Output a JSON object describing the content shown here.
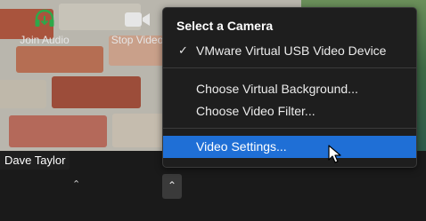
{
  "participant": {
    "name": "Dave Taylor"
  },
  "menu": {
    "title": "Select a Camera",
    "camera_device": "VMware Virtual USB Video Device",
    "items": [
      "Choose Virtual Background...",
      "Choose Video Filter..."
    ],
    "selected_item": "Video Settings..."
  },
  "toolbar": {
    "join_audio_label": "Join Audio",
    "stop_video_label": "Stop Video"
  },
  "icons": {
    "headphones": "headphones-icon",
    "camera": "video-camera-icon",
    "caret": "chevron-up-icon",
    "check": "check-icon",
    "cursor": "mouse-pointer-icon"
  },
  "colors": {
    "selection": "#1f6fd6",
    "menu_bg": "#1e1e1e",
    "join_audio_icon": "#2ea84a"
  }
}
